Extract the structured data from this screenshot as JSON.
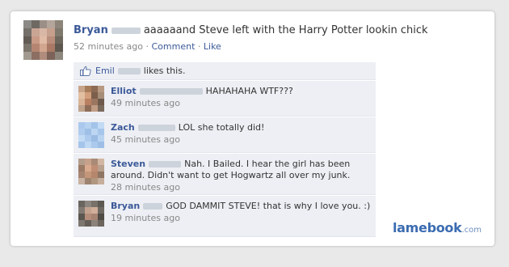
{
  "post": {
    "author": "Bryan",
    "text": "aaaaaand Steve left with the Harry Potter lookin chick",
    "time": "52 minutes ago",
    "separator": "·",
    "comment_link": "Comment",
    "like_link": "Like"
  },
  "likes": {
    "name": "Emil",
    "text": "likes this."
  },
  "comments": [
    {
      "author": "Elliot",
      "text": "HAHAHAHA WTF???",
      "time": "49 minutes ago"
    },
    {
      "author": "Zach",
      "text": "LOL she totally did!",
      "time": "45 minutes ago"
    },
    {
      "author": "Steven",
      "text": "Nah. I Bailed. I hear the girl has been around. Didn't want to get Hogwartz all over my junk.",
      "time": "28 minutes ago"
    },
    {
      "author": "Bryan",
      "text": "GOD DAMMIT STEVE! that is why I love you. :)",
      "time": "19 minutes ago"
    }
  ],
  "watermark": {
    "main": "lamebook",
    "tld": ".com"
  },
  "colors": {
    "link": "#3b5998",
    "comment_bg": "#edeff4",
    "meta_gray": "#888888",
    "watermark": "#3b6cb1"
  },
  "icons": {
    "like": "thumbs-up-icon"
  }
}
